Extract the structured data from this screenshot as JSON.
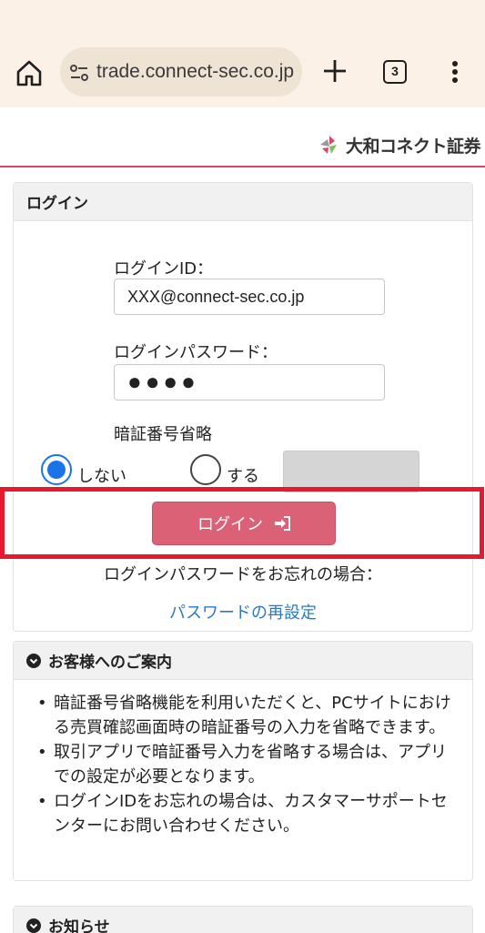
{
  "browser": {
    "url": "trade.connect-sec.co.jp",
    "tab_count": "3",
    "icons": [
      "home-icon",
      "site-settings-icon",
      "plus-icon",
      "tabs-icon",
      "more-vert-icon"
    ]
  },
  "site": {
    "logo_text": "大和コネクト証券",
    "accent_color": "#d9466a"
  },
  "login": {
    "heading": "ログイン",
    "id_label": "ログインID：",
    "id_value": "XXX@connect-sec.co.jp",
    "password_label": "ログインパスワード：",
    "password_value": "●●●●",
    "pin_label": "暗証番号省略",
    "pin_options": [
      {
        "label": "しない",
        "selected": true
      },
      {
        "label": "する",
        "selected": false
      }
    ],
    "submit_label": "ログイン",
    "submit_color": "#db6176",
    "forgot_text": "ログインパスワードをお忘れの場合：",
    "reset_link": "パスワードの再設定"
  },
  "guide": {
    "heading": "お客様へのご案内",
    "items": [
      "暗証番号省略機能を利用いただくと、PCサイトにおける売買確認画面時の暗証番号の入力を省略できます。",
      "取引アプリで暗証番号入力を省略する場合は、アプリでの設定が必要となります。",
      "ログインIDをお忘れの場合は、カスタマーサポートセンターにお問い合わせください。"
    ]
  },
  "news": {
    "heading": "お知らせ"
  },
  "highlight_color": "#e8192c"
}
